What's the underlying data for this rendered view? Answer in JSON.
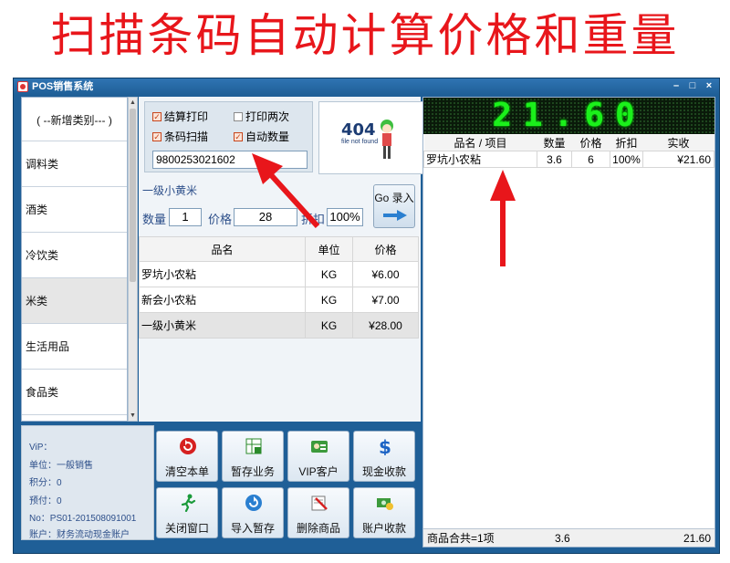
{
  "banner": {
    "title": "扫描条码自动计算价格和重量"
  },
  "window": {
    "title": "POS销售系统",
    "min": "–",
    "max": "□",
    "close": "×"
  },
  "categories": [
    {
      "label": "( --新增类别--- )"
    },
    {
      "label": "调料类"
    },
    {
      "label": "酒类"
    },
    {
      "label": "冷饮类"
    },
    {
      "label": "米类"
    },
    {
      "label": "生活用品"
    },
    {
      "label": "食品类"
    }
  ],
  "options": {
    "print_receipt": "结算打印",
    "print_twice": "打印两次",
    "barcode_scan": "条码扫描",
    "auto_quantity": "自动数量",
    "barcode_value": "9800253021602"
  },
  "logo": {
    "code": "404",
    "subtitle": "file not found"
  },
  "entry": {
    "item_name": "一级小黄米",
    "qty_label": "数量",
    "qty_value": "1",
    "price_label": "价格",
    "price_value": "28",
    "discount_label": "折扣",
    "discount_value": "100%",
    "go_label": "Go 录入"
  },
  "product_table": {
    "headers": [
      "品名",
      "单位",
      "价格"
    ],
    "rows": [
      {
        "name": "罗坑小农粘",
        "unit": "KG",
        "price": "¥6.00"
      },
      {
        "name": "新会小农粘",
        "unit": "KG",
        "price": "¥7.00"
      },
      {
        "name": "一级小黄米",
        "unit": "KG",
        "price": "¥28.00"
      }
    ]
  },
  "info": {
    "vip": "ViP：",
    "unit": "单位：一般销售",
    "points": "积分：0",
    "prepaid": "预付：0",
    "no": "No：PS01-201508091001",
    "account": "账户：财务流动现金账户"
  },
  "buttons": {
    "clear": "清空本单",
    "hold": "暂存业务",
    "vip": "VIP客户",
    "cash": "现金收款",
    "close": "关闭窗口",
    "import_hold": "导入暂存",
    "delete": "删除商品",
    "account_pay": "账户收款"
  },
  "display": {
    "total": "21.60"
  },
  "cart": {
    "headers": [
      "品名 / 项目",
      "数量",
      "价格",
      "折扣",
      "实收"
    ],
    "rows": [
      {
        "name": "罗坑小农粘",
        "qty": "3.6",
        "price": "6",
        "discount": "100%",
        "paid": "¥21.60"
      }
    ]
  },
  "summary": {
    "count": "商品合共=1项",
    "qty": "3.6",
    "total": "21.60"
  },
  "colors": {
    "banner": "#e8161b",
    "window": "#1f5f97",
    "led": "#1bf01b"
  }
}
